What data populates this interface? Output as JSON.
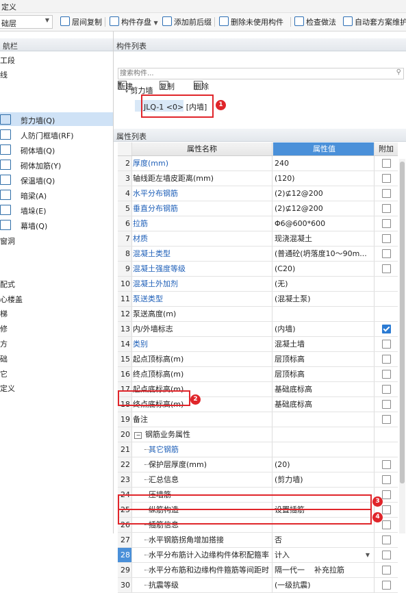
{
  "title": "定义",
  "toolbar": {
    "layer": "础层",
    "buttons": [
      "层间复制",
      "构件存盘",
      "添加前后缀",
      "删除未使用构件",
      "检查做法",
      "自动套方案维护"
    ]
  },
  "nav": {
    "header": "航栏",
    "top_items": [
      "工段",
      "线"
    ],
    "items": [
      {
        "label": "剪力墙(Q)",
        "icon": "shear-wall-icon",
        "selected": true
      },
      {
        "label": "人防门框墙(RF)",
        "icon": "civil-defense-door-icon",
        "selected": false
      },
      {
        "label": "砌体墙(Q)",
        "icon": "masonry-wall-icon",
        "selected": false
      },
      {
        "label": "砌体加筋(Y)",
        "icon": "masonry-rebar-icon",
        "selected": false
      },
      {
        "label": "保温墙(Q)",
        "icon": "insulation-wall-icon",
        "selected": false
      },
      {
        "label": "暗梁(A)",
        "icon": "hidden-beam-icon",
        "selected": false
      },
      {
        "label": "墙垛(E)",
        "icon": "wall-pier-icon",
        "selected": false
      },
      {
        "label": "幕墙(Q)",
        "icon": "curtain-wall-icon",
        "selected": false
      }
    ],
    "other_items": [
      "窗洞",
      "配式",
      "心楼盖",
      "梯",
      "修",
      "方",
      "础",
      "它",
      "定义"
    ]
  },
  "component_list": {
    "header": "构件列表",
    "new_label": "新建",
    "copy_label": "复制",
    "delete_label": "删除",
    "search_placeholder": "搜索构件...",
    "tree_group": "剪力墙",
    "tree_item": "JLQ-1 <0> [内墙]"
  },
  "property_list": {
    "header": "属性列表",
    "col_name": "属性名称",
    "col_value": "属性值",
    "col_extra": "附加",
    "rows": [
      {
        "no": "2",
        "name": "厚度(mm)",
        "value": "240",
        "blue": true,
        "cb": "off"
      },
      {
        "no": "3",
        "name": "轴线距左墙皮距离(mm)",
        "value": "(120)",
        "blue": false,
        "cb": "off"
      },
      {
        "no": "4",
        "name": "水平分布钢筋",
        "value": "(2)⊈12@200",
        "blue": true,
        "cb": "off"
      },
      {
        "no": "5",
        "name": "垂直分布钢筋",
        "value": "(2)⊈12@200",
        "blue": true,
        "cb": "off"
      },
      {
        "no": "6",
        "name": "拉筋",
        "value": "Φ6@600*600",
        "blue": true,
        "cb": "off"
      },
      {
        "no": "7",
        "name": "材质",
        "value": "现浇混凝土",
        "blue": true,
        "cb": "off"
      },
      {
        "no": "8",
        "name": "混凝土类型",
        "value": "(普通砼(坍落度10～90m...",
        "blue": true,
        "cb": "off"
      },
      {
        "no": "9",
        "name": "混凝土强度等级",
        "value": "(C20)",
        "blue": true,
        "cb": "off"
      },
      {
        "no": "10",
        "name": "混凝土外加剂",
        "value": "(无)",
        "blue": true,
        "cb": "none"
      },
      {
        "no": "11",
        "name": "泵送类型",
        "value": "(混凝土泵)",
        "blue": true,
        "cb": "none"
      },
      {
        "no": "12",
        "name": "泵送高度(m)",
        "value": "",
        "blue": false,
        "cb": "none"
      },
      {
        "no": "13",
        "name": "内/外墙标志",
        "value": "(内墙)",
        "blue": false,
        "cb": "on"
      },
      {
        "no": "14",
        "name": "类别",
        "value": "混凝土墙",
        "blue": true,
        "cb": "off"
      },
      {
        "no": "15",
        "name": "起点顶标高(m)",
        "value": "层顶标高",
        "blue": false,
        "cb": "off"
      },
      {
        "no": "16",
        "name": "终点顶标高(m)",
        "value": "层顶标高",
        "blue": false,
        "cb": "off"
      },
      {
        "no": "17",
        "name": "起点底标高(m)",
        "value": "基础底标高",
        "blue": false,
        "cb": "off"
      },
      {
        "no": "18",
        "name": "终点底标高(m)",
        "value": "基础底标高",
        "blue": false,
        "cb": "off"
      },
      {
        "no": "19",
        "name": "备注",
        "value": "",
        "blue": false,
        "cb": "off"
      },
      {
        "no": "20",
        "name": "钢筋业务属性",
        "value": "",
        "blue": false,
        "cb": "none",
        "group": true
      },
      {
        "no": "21",
        "name": "其它钢筋",
        "value": "",
        "blue": true,
        "cb": "none",
        "sub": true
      },
      {
        "no": "22",
        "name": "保护层厚度(mm)",
        "value": "(20)",
        "blue": false,
        "cb": "off",
        "sub": true
      },
      {
        "no": "23",
        "name": "汇总信息",
        "value": "(剪力墙)",
        "blue": false,
        "cb": "off",
        "sub": true
      },
      {
        "no": "24",
        "name": "压墙筋",
        "value": "",
        "blue": false,
        "cb": "off",
        "sub": true
      },
      {
        "no": "25",
        "name": "纵筋构造",
        "value": "设置插筋",
        "blue": false,
        "cb": "off",
        "sub": true
      },
      {
        "no": "26",
        "name": "插筋信息",
        "value": "",
        "blue": false,
        "cb": "off",
        "sub": true
      },
      {
        "no": "27",
        "name": "水平钢筋拐角增加搭接",
        "value": "否",
        "blue": false,
        "cb": "off",
        "sub": true
      },
      {
        "no": "28",
        "name": "水平分布筋计入边缘构件体积配箍率",
        "value": "计入",
        "blue": false,
        "cb": "off",
        "sub": true,
        "dropdown": true
      },
      {
        "no": "29",
        "name": "水平分布筋和边缘构件箍筋等间距时",
        "value": "隔一代一",
        "blue": false,
        "cb": "off",
        "sub": true,
        "extra": "补充拉筋"
      },
      {
        "no": "30",
        "name": "抗震等级",
        "value": "(一级抗震)",
        "blue": false,
        "cb": "off",
        "sub": true
      }
    ]
  },
  "annotations": [
    "1",
    "2",
    "3",
    "4"
  ],
  "colors": {
    "accent": "#4a90d9",
    "highlight": "#e0252a",
    "link": "#1e5fb8"
  }
}
